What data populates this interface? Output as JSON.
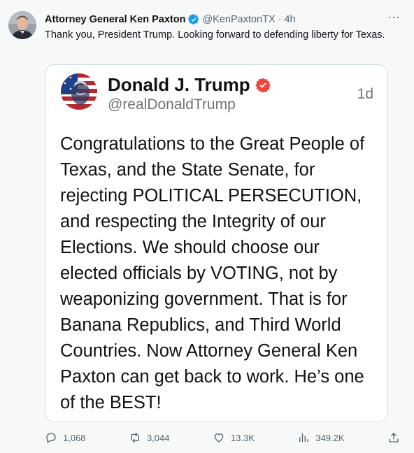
{
  "author": {
    "name": "Attorney General Ken Paxton",
    "handle": "@KenPaxtonTX",
    "separator": "·",
    "time": "4h",
    "verified_color": "#1d9bf0"
  },
  "tweet": {
    "text": "Thank you, President Trump. Looking forward to defending liberty for Texas."
  },
  "quoted_post": {
    "name": "Donald J. Trump",
    "handle": "@realDonaldTrump",
    "time": "1d",
    "badge_color": "#f0463c",
    "body": "Congratulations to the Great People of Texas, and the State Senate, for rejecting POLITICAL PERSECUTION, and respecting the Integrity of our Elections. We should choose our elected officials by VOTING, not by weaponizing government. That is for Banana Republics, and Third World Countries. Now Attorney General Ken Paxton can get back to work. He’s one of the BEST!"
  },
  "actions": {
    "replies": "1,068",
    "reposts": "3,044",
    "likes": "13.3K",
    "views": "349.2K"
  },
  "menu": {
    "more_label": "···"
  }
}
